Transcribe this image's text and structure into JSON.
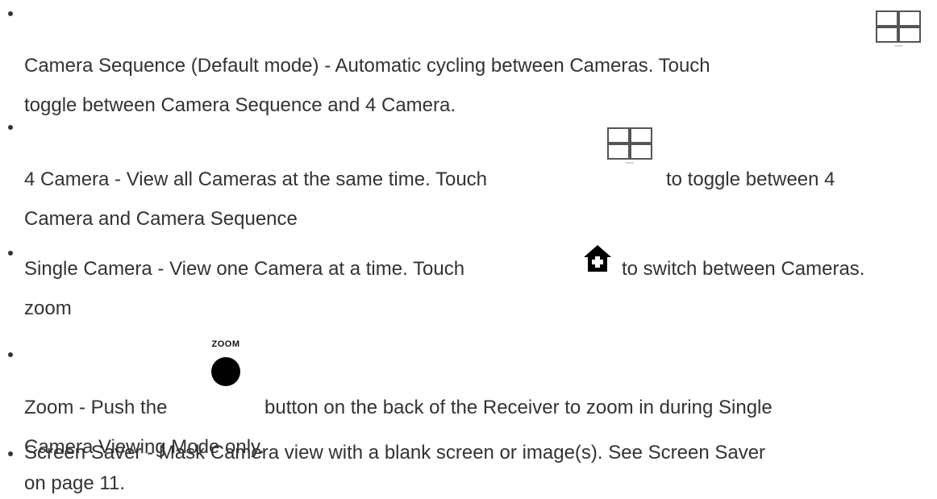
{
  "items": [
    {
      "line1": "Camera Sequence (Default mode) - Automatic cycling between Cameras. Touch",
      "line2": "toggle between Camera Sequence and 4 Camera.",
      "icon": "quad-grid-icon"
    },
    {
      "line1_before": "4 Camera - View all Cameras at the same time. Touch",
      "line1_after": "to toggle between 4",
      "line2": "Camera and Camera Sequence",
      "icon": "quad-grid-icon"
    },
    {
      "line1_before": "Single Camera - View one Camera at a time. Touch",
      "line1_after": "to switch between Cameras.",
      "line2": "zoom",
      "icon": "house-icon"
    },
    {
      "line1_before": "Zoom - Push the",
      "line1_after": "button on the back of the Receiver to zoom in during Single",
      "line2": "Camera Viewing Mode only.",
      "icon": "zoom-button-icon",
      "icon_caption": "ZOOM"
    },
    {
      "line1": "Screen Saver - Mask Camera view with a blank screen or image(s). See Screen Saver",
      "line2": "on page 11."
    }
  ],
  "colors": {
    "text": "#333333",
    "icon_line": "#555555",
    "icon_fill": "#000000"
  }
}
